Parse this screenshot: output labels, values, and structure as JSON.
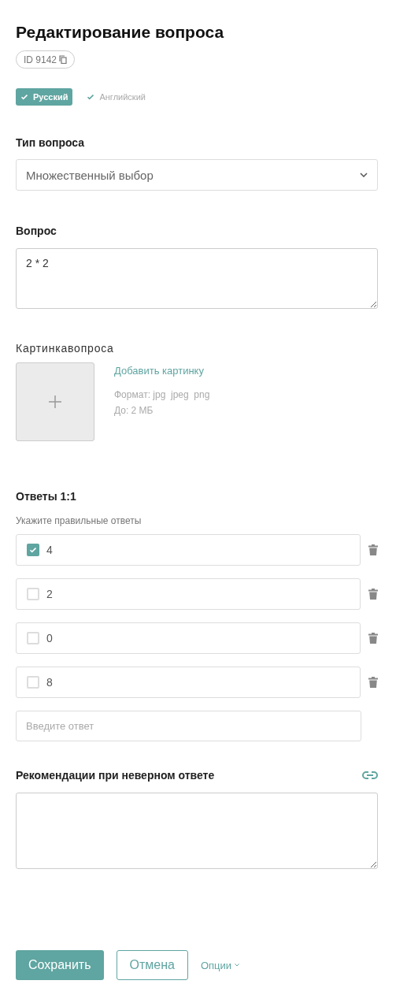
{
  "title": "Редактирование вопроса",
  "id_badge": "ID 9142",
  "languages": [
    {
      "label": "Русский",
      "selected": true
    },
    {
      "label": "Английский",
      "selected": false
    }
  ],
  "question_type": {
    "label": "Тип вопроса",
    "value": "Множественный выбор"
  },
  "question": {
    "label": "Вопрос",
    "value": "2 * 2"
  },
  "image": {
    "label": "Картинкавопроса",
    "add_link": "Добавить картинку",
    "format": "Формат: jpg  jpeg  png",
    "max_size": "До: 2 МБ"
  },
  "answers": {
    "title": "Ответы 1:1",
    "hint": "Укажите правильные ответы",
    "placeholder": "Введите ответ",
    "items": [
      {
        "text": "4",
        "checked": true
      },
      {
        "text": "2",
        "checked": false
      },
      {
        "text": "0",
        "checked": false
      },
      {
        "text": "8",
        "checked": false
      }
    ]
  },
  "recommendations": {
    "label": "Рекомендации при неверном ответе"
  },
  "buttons": {
    "save": "Сохранить",
    "cancel": "Отмена",
    "options": "Опции"
  }
}
